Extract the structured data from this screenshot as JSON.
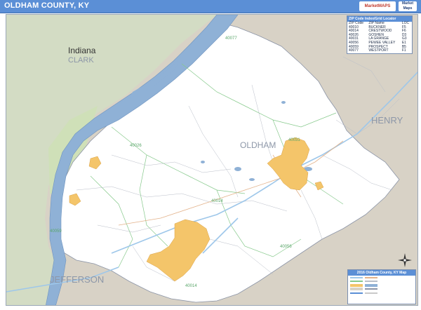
{
  "header": {
    "title": "OLDHAM COUNTY, KY",
    "logo_text": "MarketMAPS",
    "logo2_text": "Market Maps"
  },
  "map": {
    "labels": {
      "state_indiana": "Indiana",
      "county_clark": "CLARK",
      "county_oldham": "OLDHAM",
      "county_henry": "HENRY",
      "county_jefferson": "JEFFERSON"
    },
    "zips": [
      "40077",
      "40026",
      "40031",
      "40014",
      "40059",
      "40056",
      "40014"
    ]
  },
  "zip_legend": {
    "title": "ZIP Code Index/Grid Locator",
    "columns": [
      "ZIP Code",
      "ZIP Name",
      "LOC"
    ],
    "rows": [
      [
        "40010",
        "BUCKNER",
        "F5"
      ],
      [
        "40014",
        "CRESTWOOD",
        "F6"
      ],
      [
        "40026",
        "GOSHEN",
        "D3"
      ],
      [
        "40031",
        "LA GRANGE",
        "G3"
      ],
      [
        "40056",
        "PEWEE VALLEY",
        "E1"
      ],
      [
        "40059",
        "PROSPECT",
        "B5"
      ],
      [
        "40077",
        "WESTPORT",
        "F1"
      ]
    ]
  },
  "map_legend": {
    "title": "2016 Oldham County, KY Map"
  },
  "colors": {
    "title_bar": "#5b8fd6",
    "river": "#8fb1d6",
    "outside_land": "#d8d2c6",
    "indiana_land": "#cfe0b8",
    "county": "#ffffff",
    "city": "#f4c56a",
    "highway": "#9ec7ea",
    "zip_boundary": "#86c98b"
  }
}
